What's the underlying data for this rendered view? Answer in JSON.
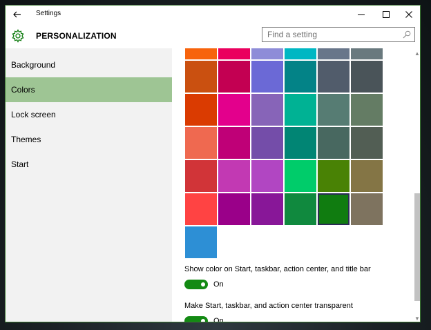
{
  "window": {
    "title": "Settings"
  },
  "header": {
    "title": "PERSONALIZATION",
    "search_placeholder": "Find a setting"
  },
  "sidebar": {
    "items": [
      {
        "label": "Background",
        "selected": false
      },
      {
        "label": "Colors",
        "selected": true
      },
      {
        "label": "Lock screen",
        "selected": false
      },
      {
        "label": "Themes",
        "selected": false
      },
      {
        "label": "Start",
        "selected": false
      }
    ]
  },
  "colors": {
    "selected_accent": "#107c10",
    "swatch_rows": [
      [
        "#f7630c",
        "#ea005e",
        "#8e8cd8",
        "#00b7c3",
        "#68768a",
        "#69797e"
      ],
      [
        "#ca5010",
        "#c30052",
        "#6b69d6",
        "#038387",
        "#515c6b",
        "#4a5459"
      ],
      [
        "#da3b01",
        "#e3008c",
        "#8764b8",
        "#00b294",
        "#567c73",
        "#647c64"
      ],
      [
        "#ef6950",
        "#bf0077",
        "#744da9",
        "#018574",
        "#486860",
        "#525e54"
      ],
      [
        "#d13438",
        "#c239b3",
        "#b146c2",
        "#00cc6a",
        "#498205",
        "#847545"
      ],
      [
        "#ff4343",
        "#9a0089",
        "#881798",
        "#10893e",
        "#107c10",
        "#7e735f"
      ],
      [
        "#2d8fd5"
      ]
    ]
  },
  "options": [
    {
      "label": "Show color on Start, taskbar, action center, and title bar",
      "state": "On",
      "on": true
    },
    {
      "label": "Make Start, taskbar, and action center transparent",
      "state": "On",
      "on": true
    }
  ],
  "theme": {
    "accent": "#107c10",
    "sidebar_selected": "#9ec594"
  }
}
